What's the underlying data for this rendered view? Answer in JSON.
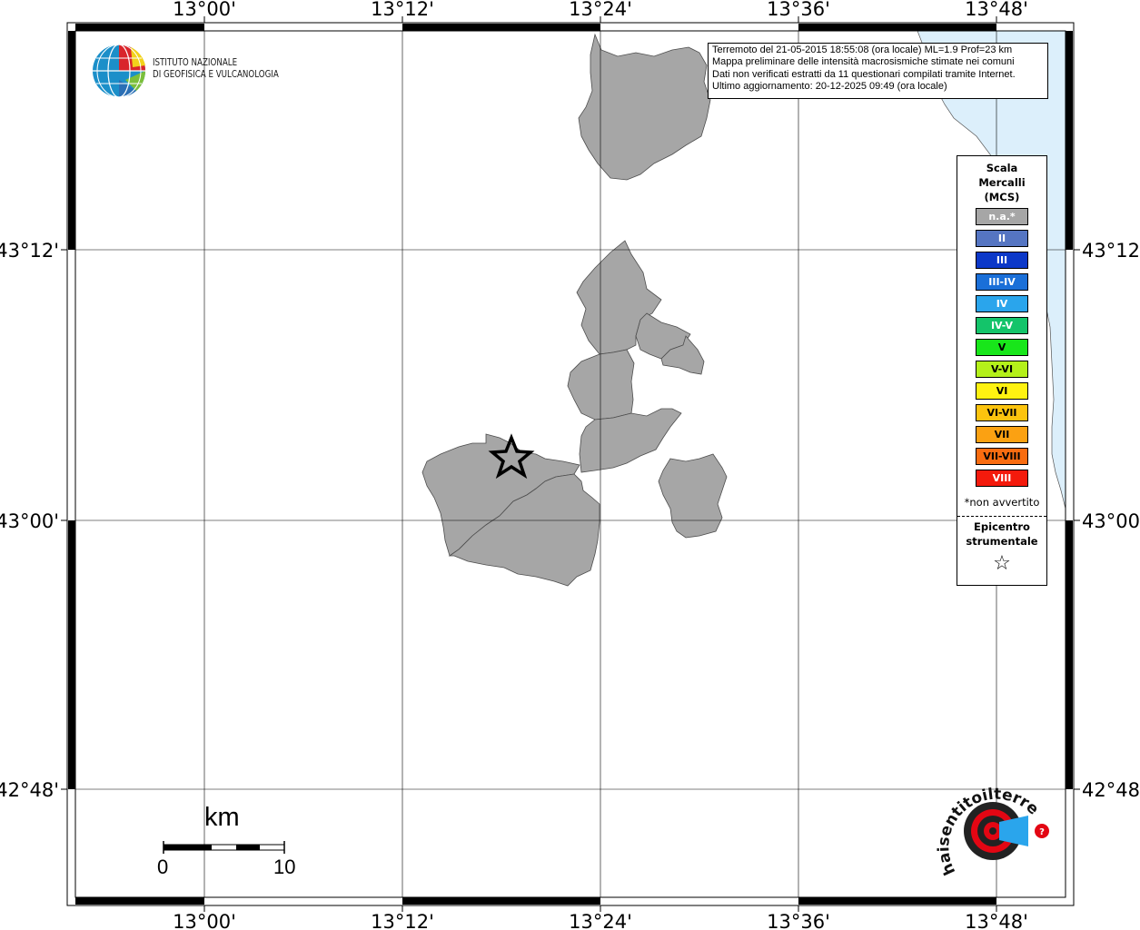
{
  "map": {
    "x_tick_labels": [
      "13°00'",
      "13°12'",
      "13°24'",
      "13°36'",
      "13°48'"
    ],
    "y_tick_labels": [
      "43°12'",
      "43°00'",
      "42°48'"
    ],
    "colors": {
      "land_not_felt": "#a6a6a6",
      "sea": "#dceffb",
      "grid": "#000000",
      "border_outline": "#4d4d4d"
    }
  },
  "logo": {
    "line1": "ISTITUTO NAZIONALE",
    "line2": "DI GEOFISICA E VULCANOLOGIA"
  },
  "info": {
    "line1": "Terremoto del 21-05-2015 18:55:08 (ora locale) ML=1.9 Prof=23 km",
    "line2": "Mappa preliminare delle intensità macrosismiche stimate nei comuni",
    "line3": "Dati non verificati estratti da 11 questionari compilati tramite Internet.",
    "line4": "Ultimo aggiornamento: 20-12-2025 09:49 (ora locale)"
  },
  "legend": {
    "title_line1": "Scala",
    "title_line2": "Mercalli",
    "title_line3": "(MCS)",
    "items": [
      {
        "label": "n.a.*",
        "color": "#a6a6a6"
      },
      {
        "label": "II",
        "color": "#5575c2"
      },
      {
        "label": "III",
        "color": "#0c38c8"
      },
      {
        "label": "III-IV",
        "color": "#1a6fd8"
      },
      {
        "label": "IV",
        "color": "#2aa5ec"
      },
      {
        "label": "IV-V",
        "color": "#14c46a"
      },
      {
        "label": "V",
        "color": "#18e61a"
      },
      {
        "label": "V-VI",
        "color": "#b4f01a"
      },
      {
        "label": "VI",
        "color": "#fff211"
      },
      {
        "label": "VI-VII",
        "color": "#fcc40e"
      },
      {
        "label": "VII",
        "color": "#fba112"
      },
      {
        "label": "VII-VIII",
        "color": "#f86c10"
      },
      {
        "label": "VIII",
        "color": "#f41a0c"
      }
    ],
    "note": "*non avvertito",
    "epicenter_line1": "Epicentro",
    "epicenter_line2": "strumentale",
    "epicenter_symbol": "☆"
  },
  "scale_bar": {
    "unit": "km",
    "min_label": "0",
    "max_label": "10"
  },
  "watermark": {
    "text": "haisentitoilterremoto.it www.",
    "brand": "haisentitoilterremoto.it"
  }
}
